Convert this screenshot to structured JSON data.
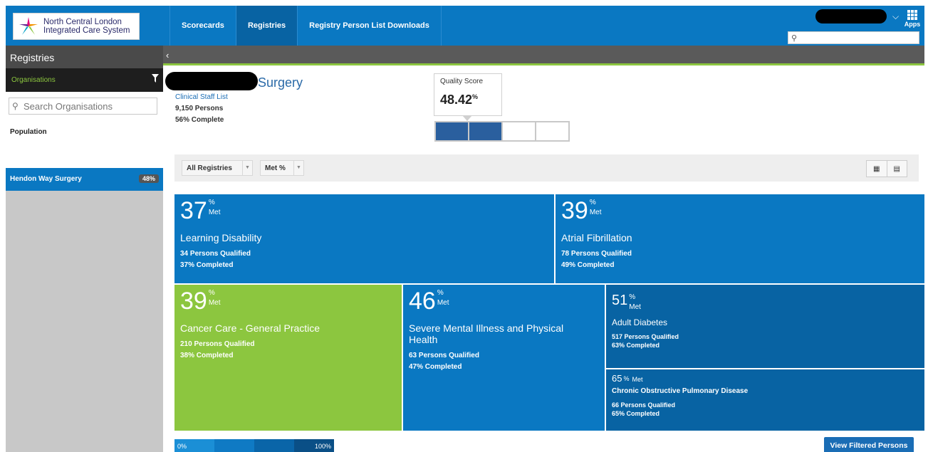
{
  "header": {
    "logo": {
      "line1": "North Central London",
      "line2": "Integrated Care System"
    },
    "nav": [
      {
        "label": "Scorecards"
      },
      {
        "label": "Registries"
      },
      {
        "label": "Registry Person List Downloads"
      }
    ],
    "apps_label": "Apps",
    "search_placeholder": ""
  },
  "sidebar": {
    "title": "Registries",
    "organisations_label": "Organisations",
    "search_placeholder": "Search Organisations",
    "population_label": "Population",
    "selected_org": {
      "name": "Hendon Way Surgery",
      "percent": "48%"
    }
  },
  "practice": {
    "name_suffix": "Surgery",
    "staff_list_link": "Clinical Staff List",
    "persons": "9,150 Persons",
    "complete": "56% Complete"
  },
  "quality_score": {
    "label": "Quality Score",
    "value": "48.42",
    "unit": "%",
    "filled_segments": 2,
    "total_segments": 4
  },
  "filters": {
    "registries_dropdown": "All Registries",
    "metric_dropdown": "Met %"
  },
  "tiles": [
    {
      "value": "37",
      "unit": "%",
      "met": "Met",
      "title": "Learning Disability",
      "qualified": "34 Persons Qualified",
      "completed": "37% Completed",
      "color": "#0a78c2"
    },
    {
      "value": "39",
      "unit": "%",
      "met": "Met",
      "title": "Atrial Fibrillation",
      "qualified": "78 Persons Qualified",
      "completed": "49% Completed",
      "color": "#0a78c2"
    },
    {
      "value": "39",
      "unit": "%",
      "met": "Met",
      "title": "Cancer Care - General Practice",
      "qualified": "210 Persons Qualified",
      "completed": "38% Completed",
      "color": "#8cc63f"
    },
    {
      "value": "46",
      "unit": "%",
      "met": "Met",
      "title": "Severe Mental Illness and Physical Health",
      "qualified": "63 Persons Qualified",
      "completed": "47% Completed",
      "color": "#0a78c2"
    },
    {
      "value": "51",
      "unit": "%",
      "met": "Met",
      "title": "Adult Diabetes",
      "qualified": "517 Persons Qualified",
      "completed": "63% Completed",
      "color": "#0863a3"
    },
    {
      "value": "65",
      "unit": "%",
      "met": "Met",
      "title": "Chronic Obstructive Pulmonary Disease",
      "qualified": "66 Persons Qualified",
      "completed": "65% Completed",
      "color": "#0863a3"
    }
  ],
  "legend": {
    "min_label": "0%",
    "max_label": "100%",
    "colors": [
      "#1b8fd6",
      "#0f7ac4",
      "#0a65a8",
      "#0a4f86"
    ]
  },
  "actions": {
    "view_filtered": "View Filtered Persons"
  }
}
